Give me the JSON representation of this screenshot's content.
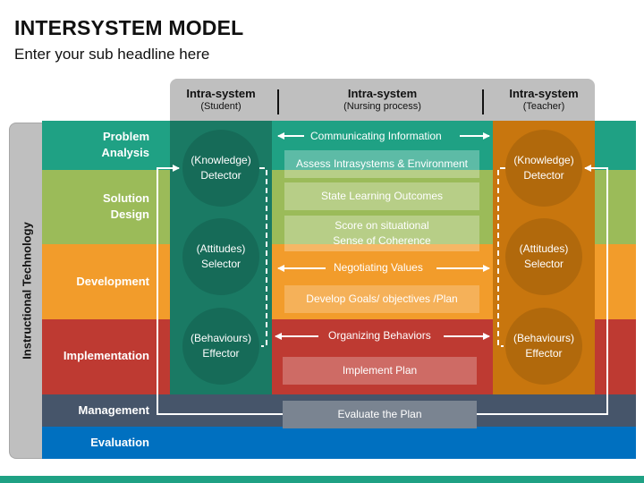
{
  "title": "INTERSYSTEM MODEL",
  "subtitle": "Enter your sub headline here",
  "side_label": "Instructional Technology",
  "header": [
    {
      "title": "Intra-system",
      "sub": "(Student)"
    },
    {
      "title": "Intra-system",
      "sub": "(Nursing process)"
    },
    {
      "title": "Intra-system",
      "sub": "(Teacher)"
    }
  ],
  "phases": [
    {
      "label_1": "Problem",
      "label_2": "Analysis",
      "color": "#1fa184"
    },
    {
      "label_1": "Solution",
      "label_2": "Design",
      "color": "#9bbb59"
    },
    {
      "label_1": "Development",
      "label_2": "",
      "color": "#f29c2b"
    },
    {
      "label_1": "Implementation",
      "label_2": "",
      "color": "#be3a32"
    },
    {
      "label_1": "Management",
      "label_2": "",
      "color": "#46556a"
    },
    {
      "label_1": "Evaluation",
      "label_2": "",
      "color": "#0070c0"
    }
  ],
  "student_column": {
    "color": "#1a7a64",
    "circles": [
      {
        "line1": "(Knowledge)",
        "line2": "Detector"
      },
      {
        "line1": "(Attitudes)",
        "line2": "Selector"
      },
      {
        "line1": "(Behaviours)",
        "line2": "Effector"
      }
    ]
  },
  "teacher_column": {
    "color": "#c8760e",
    "circles": [
      {
        "line1": "(Knowledge)",
        "line2": "Detector"
      },
      {
        "line1": "(Attitudes)",
        "line2": "Selector"
      },
      {
        "line1": "(Behaviours)",
        "line2": "Effector"
      }
    ]
  },
  "process": {
    "flows": [
      "Communicating Information",
      "Negotiating Values",
      "Organizing Behaviors"
    ],
    "steps": [
      "Assess Intrasystems & Environment",
      "State Learning Outcomes",
      "Score on situational",
      "Sense of Coherence",
      "Develop Goals/ objectives /Plan",
      "Implement Plan",
      "Evaluate the Plan"
    ]
  }
}
